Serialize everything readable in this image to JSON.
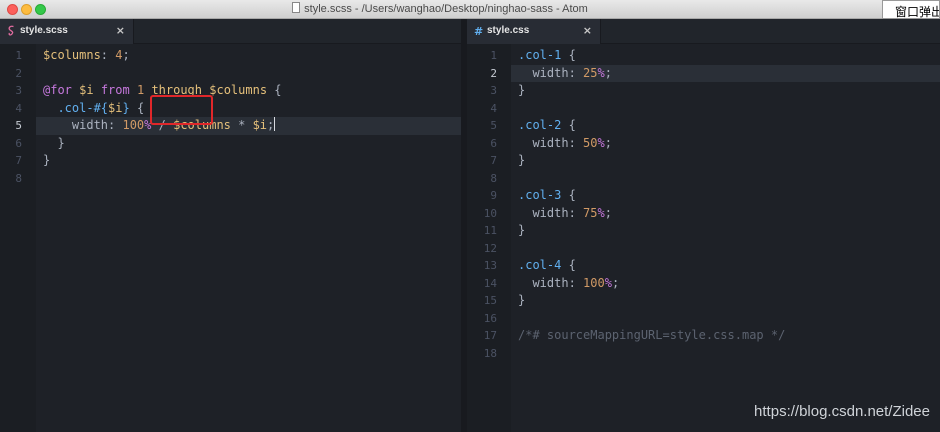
{
  "window": {
    "title": "style.scss - /Users/wanghao/Desktop/ninghao-sass - Atom",
    "popup_text": "窗口弹出"
  },
  "left_pane": {
    "tab": {
      "label": "style.scss",
      "close": "×",
      "icon": "sass-file-icon"
    },
    "line_numbers": [
      "1",
      "2",
      "3",
      "4",
      "5",
      "6",
      "7",
      "8"
    ],
    "active_line": 5,
    "lines": [
      "$columns: 4;",
      "",
      "@for $i from 1 through $columns {",
      "  .col-#{$i} {",
      "    width: 100% / $columns * $i;",
      "  }",
      "}",
      ""
    ],
    "highlighted_word": "through"
  },
  "right_pane": {
    "tab": {
      "label": "style.css",
      "close": "×",
      "icon": "css-file-icon"
    },
    "line_numbers": [
      "1",
      "2",
      "3",
      "4",
      "5",
      "6",
      "7",
      "8",
      "9",
      "10",
      "11",
      "12",
      "13",
      "14",
      "15",
      "16",
      "17",
      "18"
    ],
    "active_line": 2,
    "lines": [
      ".col-1 {",
      "  width: 25%;",
      "}",
      "",
      ".col-2 {",
      "  width: 50%;",
      "}",
      "",
      ".col-3 {",
      "  width: 75%;",
      "}",
      "",
      ".col-4 {",
      "  width: 100%;",
      "}",
      "",
      "/*# sourceMappingURL=style.css.map */",
      ""
    ]
  },
  "watermark": "https://blog.csdn.net/Zidee",
  "colors": {
    "background": "#1e2127",
    "variable": "#e5c07b",
    "number": "#d19a66",
    "keyword": "#c678dd",
    "selector": "#61afef",
    "comment": "#5c6370",
    "highlight_box": "#e0272a"
  }
}
